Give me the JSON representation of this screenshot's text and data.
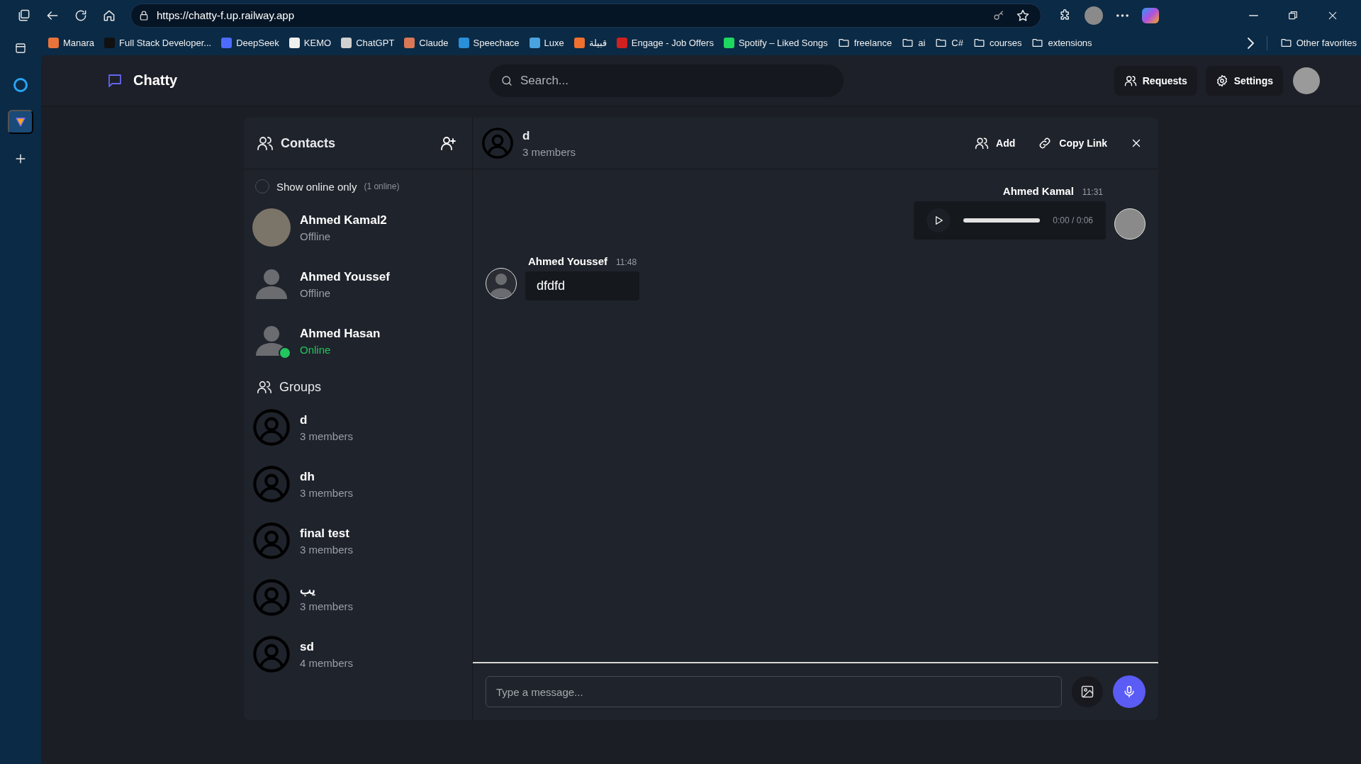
{
  "browser": {
    "url": "https://chatty-f.up.railway.app",
    "bookmarks": [
      {
        "label": "Manara",
        "kind": "site",
        "color": "#e8743b"
      },
      {
        "label": "Full Stack Developer...",
        "kind": "site",
        "color": "#111111"
      },
      {
        "label": "DeepSeek",
        "kind": "site",
        "color": "#4d6bfe"
      },
      {
        "label": "KEMO",
        "kind": "site",
        "color": "#f0f0f0"
      },
      {
        "label": "ChatGPT",
        "kind": "site",
        "color": "#d0d0d0"
      },
      {
        "label": "Claude",
        "kind": "site",
        "color": "#d97757"
      },
      {
        "label": "Speechace",
        "kind": "site",
        "color": "#2a8fd9"
      },
      {
        "label": "Luxe",
        "kind": "site",
        "color": "#4aa3df"
      },
      {
        "label": "قبيلة",
        "kind": "site",
        "color": "#f07030"
      },
      {
        "label": "Engage - Job Offers",
        "kind": "site",
        "color": "#d02020"
      },
      {
        "label": "Spotify – Liked Songs",
        "kind": "site",
        "color": "#1ed760"
      },
      {
        "label": "freelance",
        "kind": "folder"
      },
      {
        "label": "ai",
        "kind": "folder"
      },
      {
        "label": "C#",
        "kind": "folder"
      },
      {
        "label": "courses",
        "kind": "folder"
      },
      {
        "label": "extensions",
        "kind": "folder"
      }
    ],
    "other_favorites": "Other favorites"
  },
  "header": {
    "brand": "Chatty",
    "search": {
      "placeholder": "Search..."
    },
    "buttons": [
      {
        "label": "Requests",
        "kind": "requests"
      },
      {
        "label": "Settings",
        "kind": "settings"
      }
    ]
  },
  "contacts": {
    "title": "Contacts",
    "filter": {
      "label": "Show online only",
      "count": "(1 online)",
      "checked": false
    },
    "items": [
      {
        "name": "Ahmed Kamal2",
        "status": "Offline",
        "online": false,
        "photo": true
      },
      {
        "name": "Ahmed Youssef",
        "status": "Offline",
        "online": false,
        "photo": false
      },
      {
        "name": "Ahmed Hasan",
        "status": "Online",
        "online": true,
        "photo": false
      }
    ]
  },
  "groups": {
    "title": "Groups",
    "items": [
      {
        "name": "d",
        "members": "3 members"
      },
      {
        "name": "dh",
        "members": "3 members"
      },
      {
        "name": "final test",
        "members": "3 members"
      },
      {
        "name": "يب",
        "members": "3 members"
      },
      {
        "name": "sd",
        "members": "4 members"
      }
    ]
  },
  "chat": {
    "title": "d",
    "subtitle": "3 members",
    "actions": [
      {
        "label": "Add",
        "kind": "add"
      },
      {
        "label": "Copy Link",
        "kind": "link"
      }
    ],
    "messages": [
      {
        "kind": "audio",
        "own": true,
        "sender": "Ahmed Kamal",
        "time": "11:31",
        "duration": "0:00 / 0:06",
        "photo": true
      },
      {
        "kind": "text",
        "own": false,
        "sender": "Ahmed Youssef",
        "time": "11:48",
        "text": "dfdfd",
        "photo": false
      }
    ],
    "composer": {
      "placeholder": "Type a message..."
    }
  }
}
